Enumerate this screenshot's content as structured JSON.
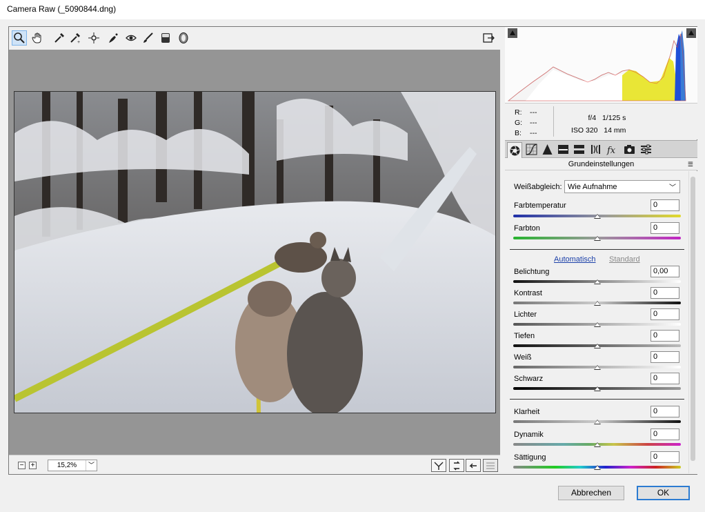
{
  "window": {
    "title": "Camera Raw (_5090844.dng)"
  },
  "toolbar": {
    "tools": [
      "zoom-tool",
      "hand-tool",
      "white-balance-tool",
      "color-sampler-tool",
      "targeted-adjustment-tool",
      "spot-removal-tool",
      "red-eye-tool",
      "adjustment-brush-tool",
      "graduated-filter-tool",
      "radial-filter-tool"
    ],
    "open_preferences_icon": "open-in-editor-icon"
  },
  "preview": {
    "zoom": {
      "minus": "−",
      "plus": "+",
      "value": "15,2%"
    },
    "view_buttons": [
      "before-after-icon",
      "swap-icon",
      "copy-settings-icon",
      "preview-toggle-icon"
    ]
  },
  "info": {
    "r_label": "R:",
    "r_value": "---",
    "g_label": "G:",
    "g_value": "---",
    "b_label": "B:",
    "b_value": "---",
    "aperture": "f/4",
    "shutter": "1/125 s",
    "iso": "ISO 320",
    "focal": "14 mm"
  },
  "panel": {
    "title": "Grundeinstellungen",
    "white_balance": {
      "label": "Weißabgleich:",
      "value": "Wie Aufnahme"
    },
    "temperature": {
      "label": "Farbtemperatur",
      "value": "0",
      "level": 0.5
    },
    "tint": {
      "label": "Farbton",
      "value": "0",
      "level": 0.5
    },
    "auto_label": "Automatisch",
    "default_label": "Standard",
    "exposure": {
      "label": "Belichtung",
      "value": "0,00",
      "level": 0.5
    },
    "contrast": {
      "label": "Kontrast",
      "value": "0",
      "level": 0.5
    },
    "highlights": {
      "label": "Lichter",
      "value": "0",
      "level": 0.5
    },
    "shadows": {
      "label": "Tiefen",
      "value": "0",
      "level": 0.5
    },
    "whites": {
      "label": "Weiß",
      "value": "0",
      "level": 0.5
    },
    "blacks": {
      "label": "Schwarz",
      "value": "0",
      "level": 0.5
    },
    "clarity": {
      "label": "Klarheit",
      "value": "0",
      "level": 0.5
    },
    "vibrance": {
      "label": "Dynamik",
      "value": "0",
      "level": 0.5
    },
    "saturation": {
      "label": "Sättigung",
      "value": "0",
      "level": 0.5
    }
  },
  "footer": {
    "cancel": "Abbrechen",
    "ok": "OK"
  },
  "colors": {
    "accent": "#2b7bd1",
    "link": "#1a3fa8",
    "canvas": "#959595"
  }
}
